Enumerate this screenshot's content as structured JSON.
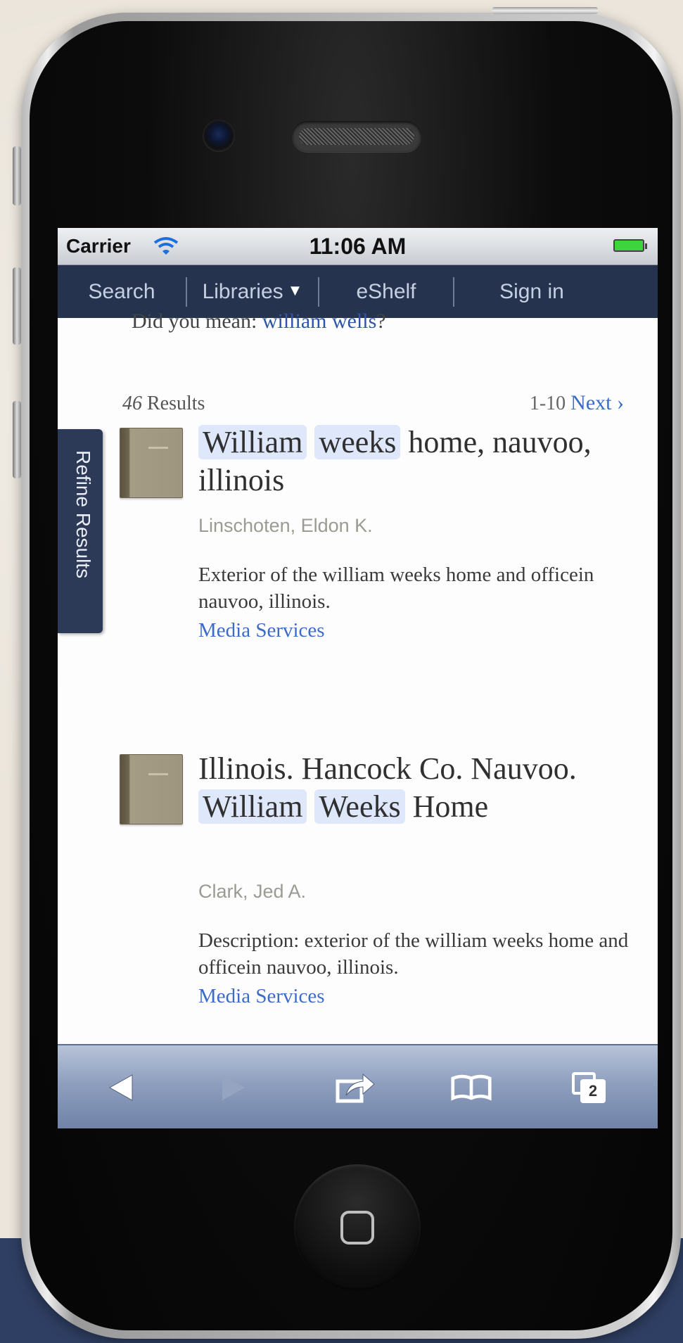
{
  "status_bar": {
    "carrier": "Carrier",
    "time": "11:06 AM"
  },
  "nav": {
    "search": "Search",
    "libraries": "Libraries",
    "eshelf": "eShelf",
    "sign_in": "Sign in"
  },
  "did_you_mean": {
    "prefix": "Did you mean: ",
    "suggestion": "william wells",
    "suffix": "?"
  },
  "results": {
    "count": "46",
    "label": " Results",
    "range": "1-10",
    "next": "Next"
  },
  "refine_label": "Refine Results",
  "items": [
    {
      "title_parts": [
        "William",
        "weeks",
        "home,",
        "nauvoo, illinois"
      ],
      "author": "Linschoten, Eldon K.",
      "description": "Exterior of the william weeks home and officein nauvoo, illinois.",
      "link": "Media Services"
    },
    {
      "title_parts": [
        "Illinois. Hancock Co.",
        "Nauvoo.",
        "William",
        "Weeks",
        "Home"
      ],
      "author": "Clark, Jed A.",
      "description": "Description: exterior of the william weeks home and officein nauvoo, illinois.",
      "link": "Media Services"
    }
  ],
  "toolbar": {
    "tabs_count": "2"
  },
  "colors": {
    "nav_background": "#26334f",
    "link_blue": "#3b6cc8",
    "highlight": "#dfe7fb"
  }
}
